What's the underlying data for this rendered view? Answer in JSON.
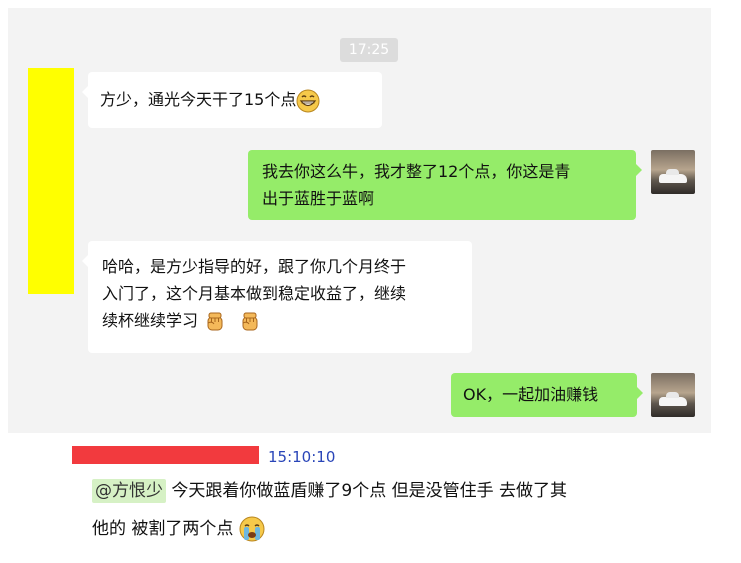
{
  "chat": {
    "timestamp": "17:25",
    "messages": [
      {
        "side": "left",
        "text": "方少，通光今天干了15个点",
        "emoji": "grinning-face-icon"
      },
      {
        "side": "right",
        "line1": "我去你这么牛，我才整了12个点，你这是青",
        "line2": "出于蓝胜于蓝啊"
      },
      {
        "side": "left",
        "line1": "哈哈，是方少指导的好，跟了你几个月终于",
        "line2": "入门了，这个月基本做到稳定收益了，继续",
        "line3": "续杯继续学习",
        "emoji": "raised-fist-icon"
      },
      {
        "side": "right",
        "text": "OK，一起加油赚钱"
      }
    ]
  },
  "comment": {
    "time": "15:10:10",
    "mention": "@方恨少",
    "line1": " 今天跟着你做蓝盾赚了9个点 但是没管住手 去做了其",
    "line2": "他的 被割了两个点 ",
    "emoji": "crying-face-icon"
  },
  "colors": {
    "chat_bg": "#f3f3f3",
    "bubble_right": "#95ec69",
    "bubble_left": "#ffffff",
    "redaction_yellow": "#ffff00",
    "redaction_red": "#f23a3e",
    "time_blue": "#2945b8"
  }
}
